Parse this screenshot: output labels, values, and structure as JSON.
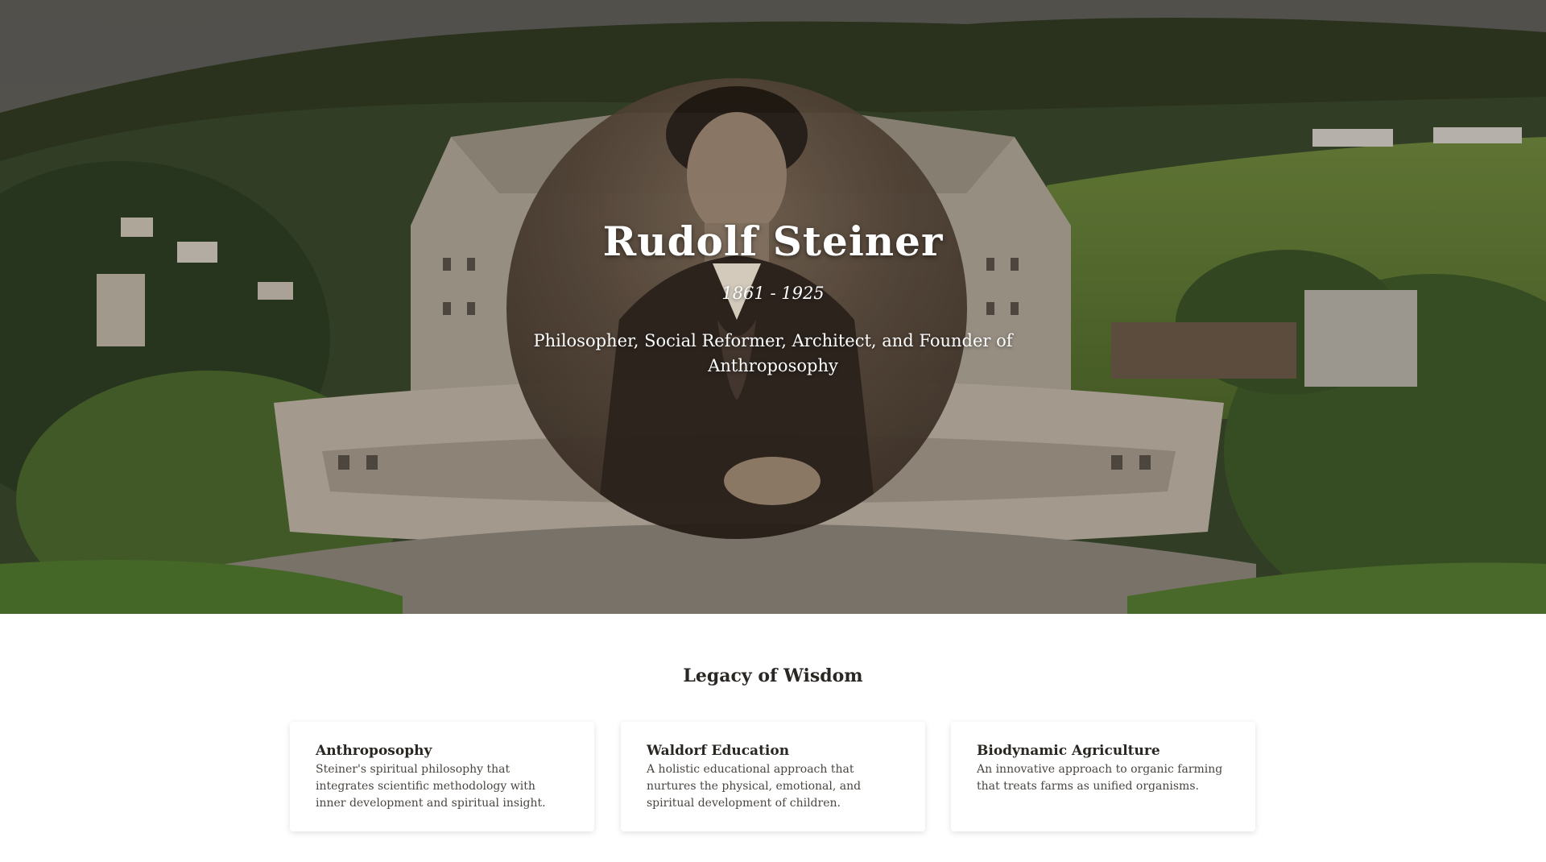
{
  "hero": {
    "title": "Rudolf Steiner",
    "years": "1861 - 1925",
    "subtitle": "Philosopher, Social Reformer, Architect, and Founder of Anthroposophy"
  },
  "legacy": {
    "title": "Legacy of Wisdom",
    "cards": [
      {
        "title": "Anthroposophy",
        "text": "Steiner's spiritual philosophy that integrates scientific methodology with inner development and spiritual insight."
      },
      {
        "title": "Waldorf Education",
        "text": "A holistic educational approach that nurtures the physical, emotional, and spiritual development of children."
      },
      {
        "title": "Biodynamic Agriculture",
        "text": "An innovative approach to organic farming that treats farms as unified organisms."
      }
    ]
  }
}
